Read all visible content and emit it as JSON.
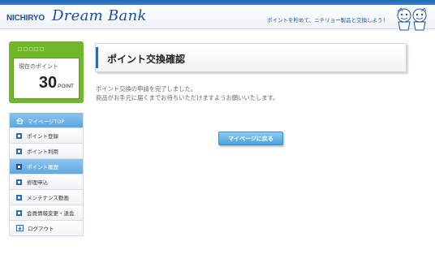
{
  "header": {
    "logo_brand": "NICHIRYO",
    "logo_script": "Dream Bank",
    "tagline": "ポイントを貯めて、ニチリョー製品と交換しよう！",
    "mascot_icon": "mascot-characters"
  },
  "points": {
    "header": "□□□□□",
    "label": "現在のポイント",
    "value": "30",
    "unit": "POINT"
  },
  "nav": {
    "items": [
      {
        "label": "マイページTOP",
        "icon": "home-icon"
      },
      {
        "label": "ポイント登録",
        "icon": "bullet-icon"
      },
      {
        "label": "ポイント利用",
        "icon": "bullet-icon"
      },
      {
        "label": "ポイント履歴",
        "icon": "bullet-icon"
      },
      {
        "label": "修理申込",
        "icon": "bullet-icon"
      },
      {
        "label": "メンテナンス動画",
        "icon": "bullet-icon"
      },
      {
        "label": "会員情報変更・退会",
        "icon": "bullet-icon"
      },
      {
        "label": "ログアウト",
        "icon": "logout-icon"
      }
    ]
  },
  "main": {
    "title": "ポイント交換確認",
    "message_line1": "ポイント交換の申請を完了しました。",
    "message_line2": "商品がお手元に届くまでお待ちいただけますようお願いいたします。",
    "button_label": "マイページに戻る"
  },
  "colors": {
    "brand_blue": "#1d4f9c",
    "points_green": "#70b82a",
    "button_blue": "#4aa1dc"
  }
}
